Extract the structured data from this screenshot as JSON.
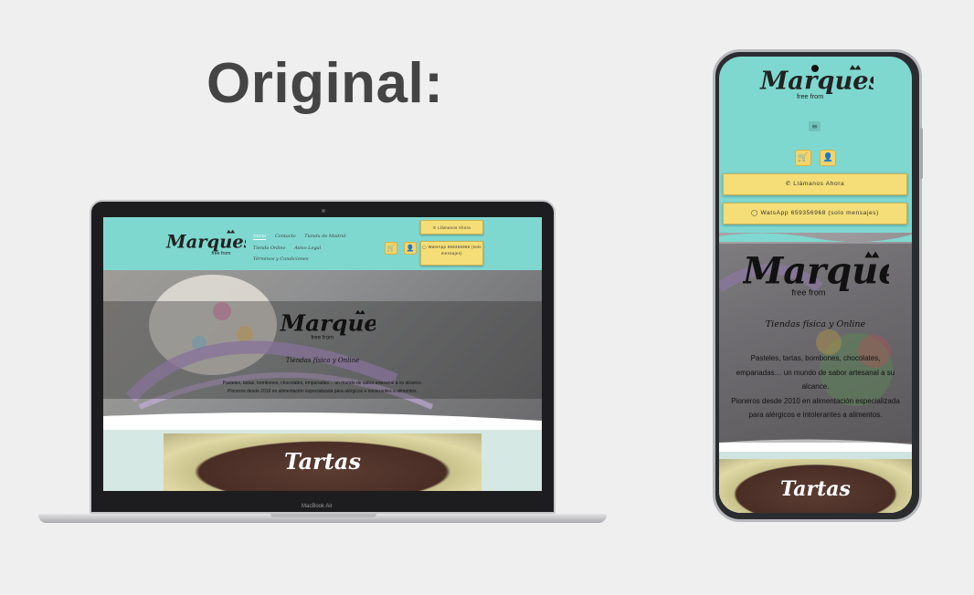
{
  "heading": "Original:",
  "brand": {
    "name": "Marques",
    "tagline": "free from"
  },
  "laptop": {
    "model_label": "MacBook Air",
    "nav": [
      "Inicio",
      "Contacto",
      "Tienda de Madrid",
      "Tienda Online",
      "Aviso Legal",
      "Términos y Condiciones"
    ],
    "call_button": "Llámanos Ahora",
    "whatsapp_button": "WatsApp 659356968 (solo mensajes)"
  },
  "phone": {
    "call_button": "Llámanos Ahora",
    "whatsapp_button": "WatsApp 659356968 (solo mensajes)"
  },
  "hero": {
    "subtitle": "Tiendas física y Online",
    "line1": "Pasteles, tartas, bombones, chocolates, empanadas… un mundo de sabor artesanal a su alcance.",
    "line2": "Pioneros desde 2010 en alimentación especializada para alérgicos e intolerantes a alimentos."
  },
  "section": {
    "title": "Tartas"
  },
  "colors": {
    "header": "#7fd8d0",
    "button": "#f5de77",
    "text": "#111111"
  },
  "icons": [
    "cart-icon",
    "user-icon",
    "phone-icon",
    "whatsapp-icon",
    "menu-icon",
    "crown-icon"
  ]
}
